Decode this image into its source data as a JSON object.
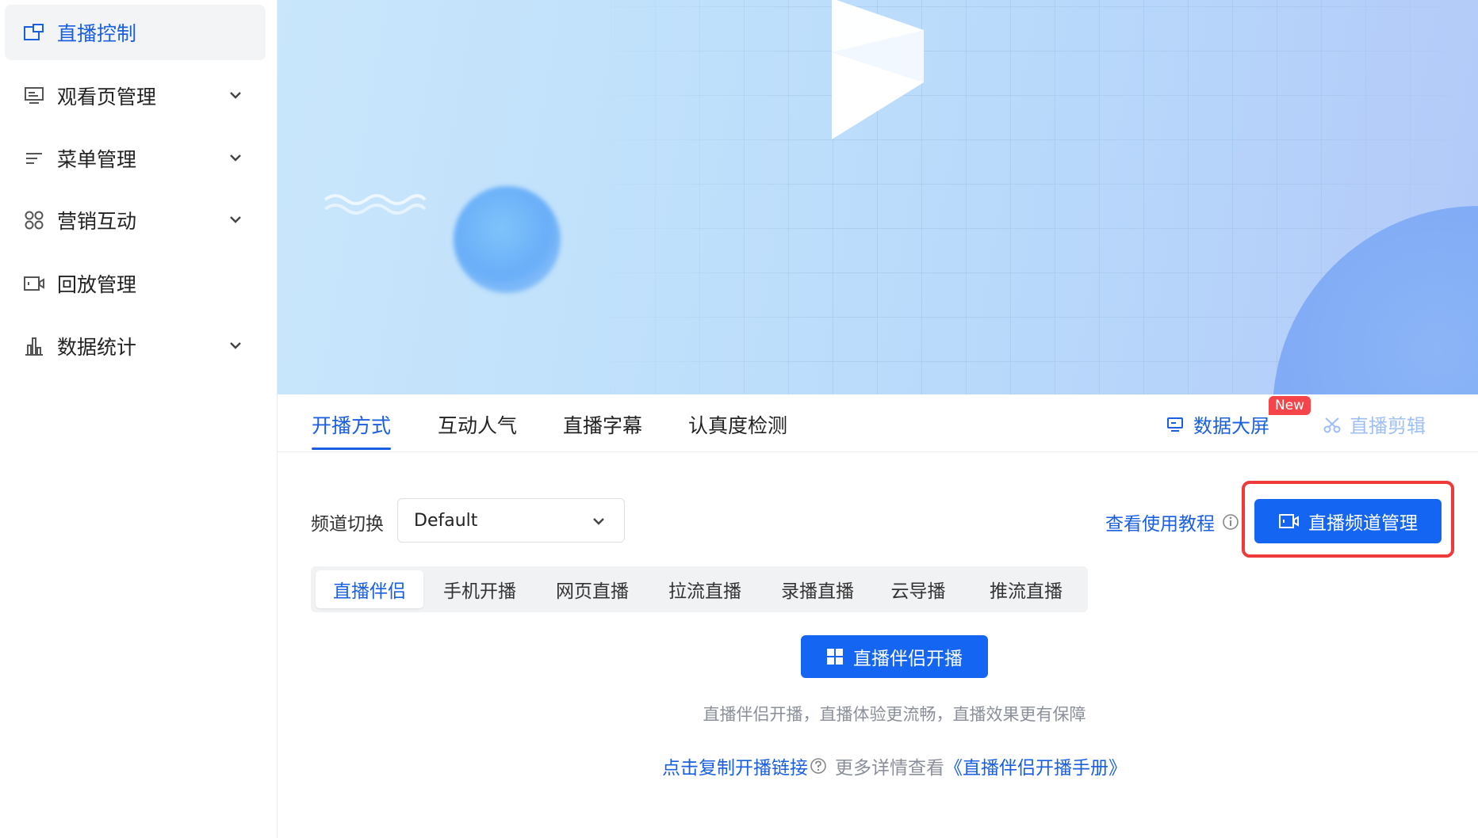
{
  "sidebar": {
    "items": [
      {
        "label": "直播控制",
        "icon": "live-control-icon",
        "active": true
      },
      {
        "label": "观看页管理",
        "icon": "watch-page-icon",
        "expandable": true
      },
      {
        "label": "菜单管理",
        "icon": "menu-list-icon",
        "expandable": true
      },
      {
        "label": "营销互动",
        "icon": "apps-grid-icon",
        "expandable": true
      },
      {
        "label": "回放管理",
        "icon": "video-camera-icon",
        "expandable": false
      },
      {
        "label": "数据统计",
        "icon": "bar-chart-icon",
        "expandable": true
      }
    ]
  },
  "tabs": {
    "items": [
      "开播方式",
      "互动人气",
      "直播字幕",
      "认真度检测"
    ],
    "active": "开播方式"
  },
  "tools": {
    "data_screen": "数据大屏",
    "new_badge": "New",
    "live_clip": "直播剪辑"
  },
  "channel": {
    "label": "频道切换",
    "selected": "Default",
    "help_link": "查看使用教程",
    "manage_button": "直播频道管理"
  },
  "modes": {
    "items": [
      "直播伴侣",
      "手机开播",
      "网页直播",
      "拉流直播",
      "录播直播",
      "云导播",
      "推流直播"
    ],
    "active": "直播伴侣"
  },
  "start": {
    "button": "直播伴侣开播",
    "description": "直播伴侣开播，直播体验更流畅，直播效果更有保障",
    "copy_link": "点击复制开播链接",
    "more_text": "更多详情查看",
    "manual_link": "《直播伴侣开播手册》"
  },
  "colors": {
    "accent": "#1565f3",
    "highlight": "#ee3a3a",
    "badge": "#f5454a"
  }
}
